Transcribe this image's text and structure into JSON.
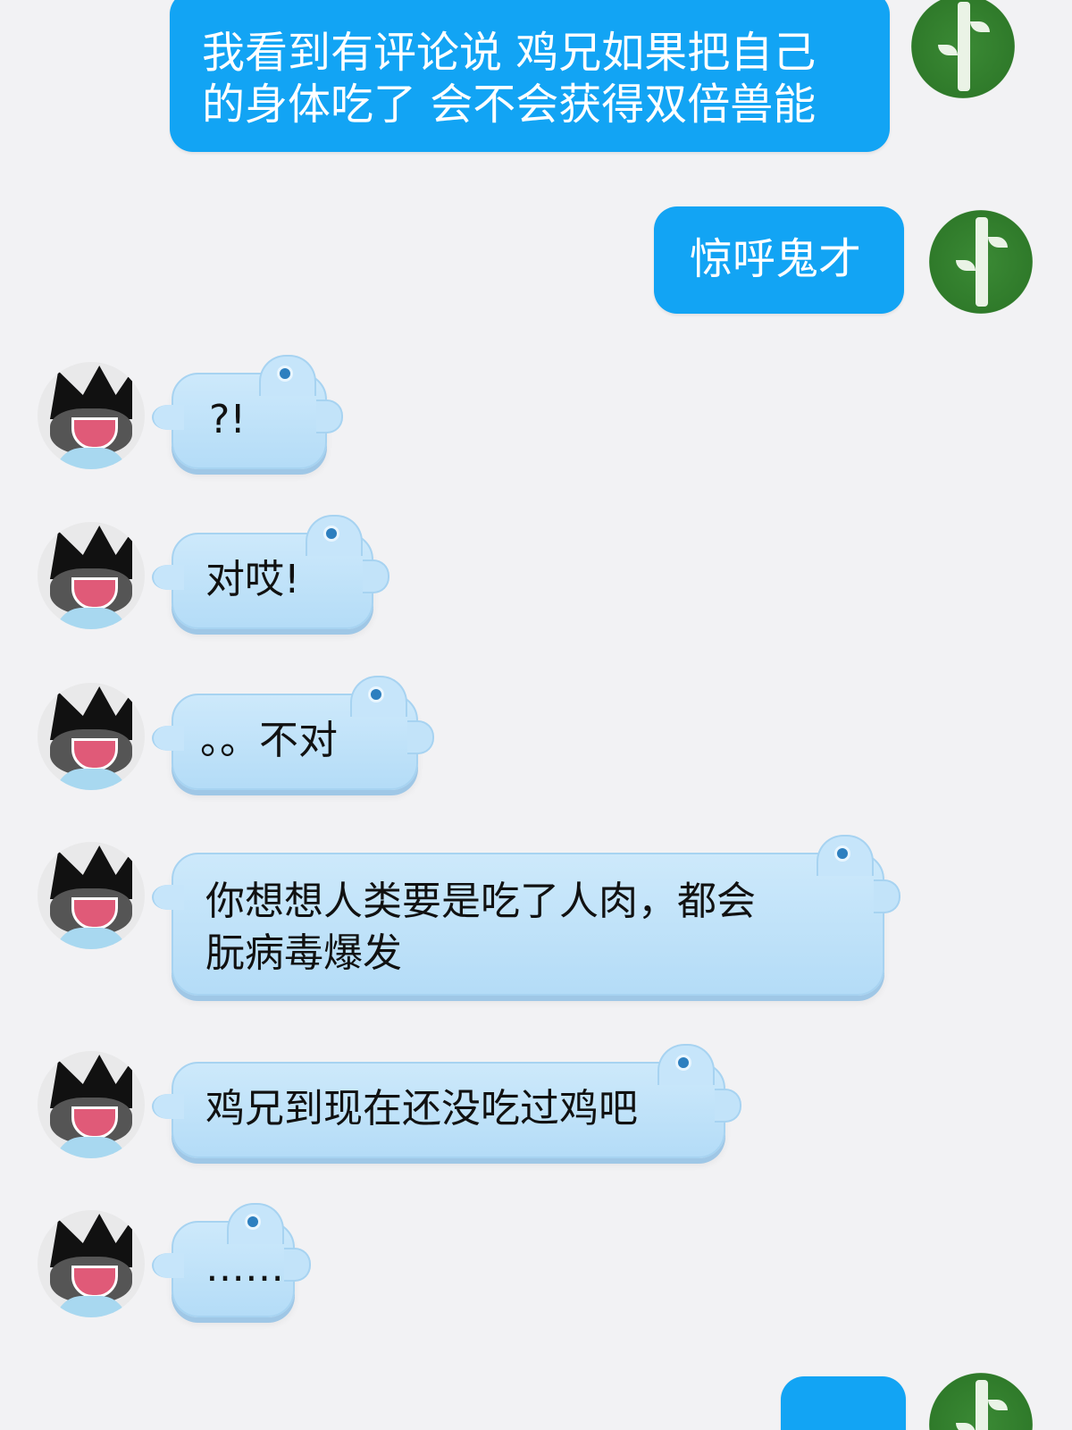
{
  "messages": [
    {
      "side": "right",
      "text": "我看到有评论说 鸡兄如果把自己\n的身体吃了 会不会获得双倍兽能"
    },
    {
      "side": "right",
      "text": "惊呼鬼才"
    },
    {
      "side": "left",
      "text": "?!"
    },
    {
      "side": "left",
      "text": "对哎!"
    },
    {
      "side": "left",
      "text": "。。不对"
    },
    {
      "side": "left",
      "text": "你想想人类要是吃了人肉，都会\n朊病毒爆发"
    },
    {
      "side": "left",
      "text": "鸡兄到现在还没吃过鸡吧"
    },
    {
      "side": "left",
      "text": "……"
    },
    {
      "side": "right",
      "text": ""
    }
  ],
  "colors": {
    "background": "#f2f2f4",
    "self_bubble": "#12a4f4",
    "other_bubble": "#c6e5fa"
  },
  "avatars": {
    "self": "bamboo-avatar",
    "other": "black-hat-character-avatar"
  }
}
